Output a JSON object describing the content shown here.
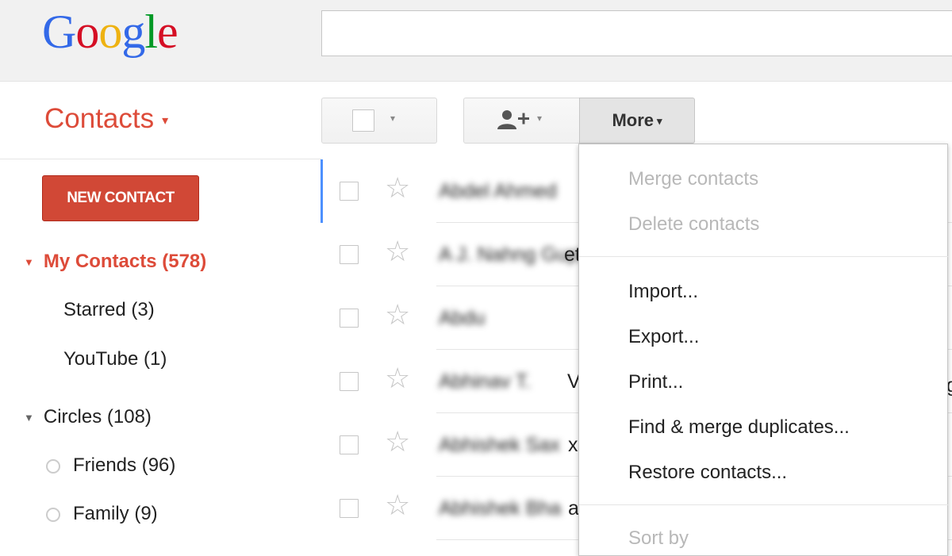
{
  "header": {
    "logo_letters": [
      {
        "ch": "G",
        "color": "#3369e8"
      },
      {
        "ch": "o",
        "color": "#d50f25"
      },
      {
        "ch": "o",
        "color": "#eeb211"
      },
      {
        "ch": "g",
        "color": "#3369e8"
      },
      {
        "ch": "l",
        "color": "#009925"
      },
      {
        "ch": "e",
        "color": "#d50f25"
      }
    ],
    "search_value": ""
  },
  "app": {
    "title": "Contacts",
    "title_caret": "▾"
  },
  "toolbar": {
    "select_caret": "▾",
    "add_caret": "▾",
    "more_label": "More",
    "more_caret": "▾"
  },
  "sidebar": {
    "new_contact_label": "NEW CONTACT",
    "my_contacts": "My Contacts (578)",
    "starred": "Starred (3)",
    "youtube": "YouTube (1)",
    "circles": "Circles (108)",
    "friends": "Friends (96)",
    "family": "Family (9)",
    "expand_icon": "▼"
  },
  "contacts": {
    "star_icon": "☆",
    "rows": [
      {
        "name": "Abdel Ahmed",
        "tail": ""
      },
      {
        "name": "A J. Nahng Gupta",
        "tail": "et"
      },
      {
        "name": "Abdu",
        "tail": ""
      },
      {
        "name": "Abhinav T.",
        "tail": "V"
      },
      {
        "name": "Abhishek Sax",
        "tail": "x"
      },
      {
        "name": "Abhishek Bha",
        "tail": "a"
      }
    ]
  },
  "more_menu": {
    "merge": "Merge contacts",
    "delete": "Delete contacts",
    "import": "Import...",
    "export": "Export...",
    "print": "Print...",
    "find_merge": "Find & merge duplicates...",
    "restore": "Restore contacts...",
    "sort_by": "Sort by"
  },
  "edge_text": "g"
}
